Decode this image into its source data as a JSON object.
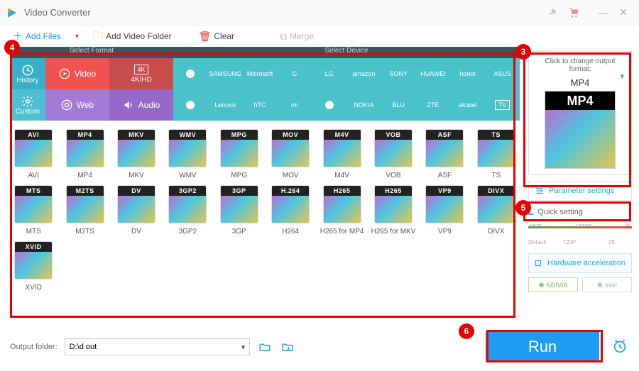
{
  "app": {
    "title": "Video Converter"
  },
  "toolbar": {
    "add_files": "Add Files",
    "add_folder": "Add Video Folder",
    "clear": "Clear",
    "merge": "Merge"
  },
  "strip": {
    "select_format": "Select Format",
    "select_device": "Select Device",
    "history": "History",
    "custom": "Custom",
    "video": "Video",
    "web": "Web",
    "khd": "4K/HD",
    "audio": "Audio",
    "brands": [
      "",
      "SAMSUNG",
      "Microsoft",
      "G",
      "LG",
      "amazon",
      "SONY",
      "HUAWEI",
      "honor",
      "ASUS",
      "",
      "Lenovo",
      "hTC",
      "mi",
      "",
      "NOKIA",
      "BLU",
      "ZTE",
      "alcatel",
      "TV"
    ]
  },
  "formats": {
    "row1": [
      "AVI",
      "MP4",
      "MKV",
      "WMV",
      "MPG",
      "MOV",
      "M4V",
      "VOB",
      "ASF",
      "TS"
    ],
    "row2": [
      "MTS",
      "M2TS",
      "DV",
      "3GP2",
      "3GP",
      "H264",
      "H265 for MP4",
      "H265 for MKV",
      "VP9",
      "DIVX"
    ],
    "row2tags": [
      "MTS",
      "M2TS",
      "DV",
      "3GP2",
      "3GP",
      "H.264",
      "H265",
      "H265",
      "VP9",
      "DIVX"
    ],
    "row3": [
      "XVID"
    ],
    "row3tags": [
      "XVID"
    ]
  },
  "output": {
    "click_hdr": "Click to change output format:",
    "name": "MP4",
    "bigtag": "MP4",
    "parameter": "Parameter settings",
    "quick": "Quick setting",
    "ticks_top": [
      "480P",
      "1080P",
      "4K"
    ],
    "ticks_bot": [
      "Default",
      "720P",
      "",
      "2K",
      ""
    ],
    "hw": "Hardware acceleration",
    "nvidia": "NDIVIA",
    "intel": "Intel"
  },
  "bottom": {
    "label": "Output folder:",
    "path": "D:\\d out",
    "run": "Run"
  },
  "annotations": {
    "3": "3",
    "4": "4",
    "5": "5",
    "6": "6"
  }
}
